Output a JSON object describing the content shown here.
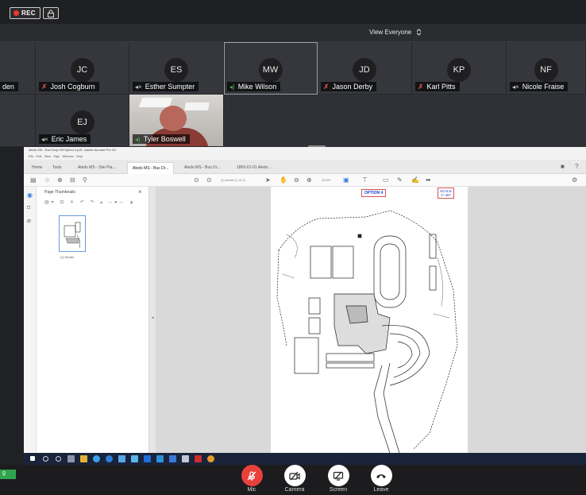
{
  "topbar": {
    "rec_label": "REC",
    "view_label": "View Everyone"
  },
  "participants": [
    {
      "initials": "",
      "name": "den",
      "audio": "none"
    },
    {
      "initials": "JC",
      "name": "Josh Cogburn",
      "audio": "muted"
    },
    {
      "initials": "ES",
      "name": "Esther Sumpter",
      "audio": "speaker"
    },
    {
      "initials": "MW",
      "name": "Mike Wilson",
      "audio": "speaking"
    },
    {
      "initials": "JD",
      "name": "Jason Derby",
      "audio": "muted"
    },
    {
      "initials": "KP",
      "name": "Karl Pitts",
      "audio": "muted"
    },
    {
      "initials": "NF",
      "name": "Nicole Fraise",
      "audio": "speaker"
    },
    {
      "initials": "EJ",
      "name": "Eric James",
      "audio": "speaker"
    },
    {
      "initials": "",
      "name": "Tyler Boswell",
      "audio": "speaking"
    }
  ],
  "share": {
    "window_title": "Aledo MS - Bus Drop Off Option 4.pdf - Adobe Acrobat Pro DC",
    "menu": "File Edit View Sign Window Help",
    "tabs": [
      "Home",
      "Tools",
      "Aledo MS - Site Pla...",
      "Aledo MS - Bus Dr...",
      "Aledo MS - Bus Dr...",
      "1865-01-01 Aledo ..."
    ],
    "page_indicator": "(1) Model  (1 of 1)",
    "zoom": "19.5%",
    "panel_title": "Page Thumbnails",
    "thumb_label": "(1) Model",
    "option_label": "OPTION 4",
    "scale_label_line1": "SCALE",
    "scale_label_line2": "1\"=60'"
  },
  "controls": {
    "chip_label": "g",
    "mic_label": "Mic",
    "camera_label": "Camera",
    "screen_label": "Screen",
    "leave_label": "Leave"
  },
  "colors": {
    "muted": "#ef5350",
    "speaking": "#4caf50",
    "mic_button": "#e8413c",
    "chip": "#2ea44f"
  }
}
